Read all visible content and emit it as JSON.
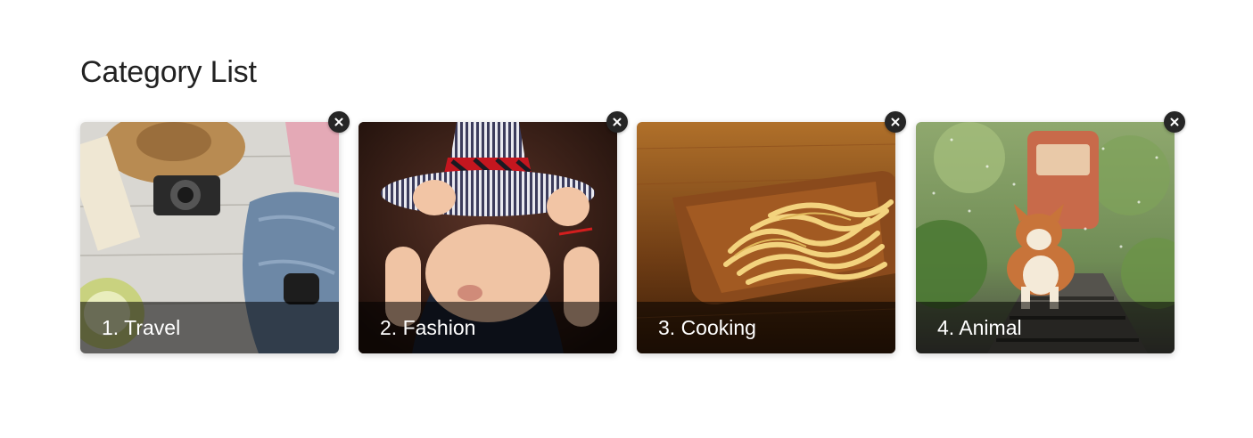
{
  "page": {
    "title": "Category List"
  },
  "categories": [
    {
      "label": "1. Travel",
      "image": "travel-flatlay-photo"
    },
    {
      "label": "2. Fashion",
      "image": "child-striped-hat-photo"
    },
    {
      "label": "3. Cooking",
      "image": "pasta-wooden-plate-photo"
    },
    {
      "label": "4. Animal",
      "image": "corgi-railway-photo"
    }
  ],
  "icons": {
    "remove": "close-icon"
  },
  "colors": {
    "remove_button": "#262626",
    "label_overlay": "rgba(0,0,0,0.55)",
    "title_text": "#222222"
  }
}
